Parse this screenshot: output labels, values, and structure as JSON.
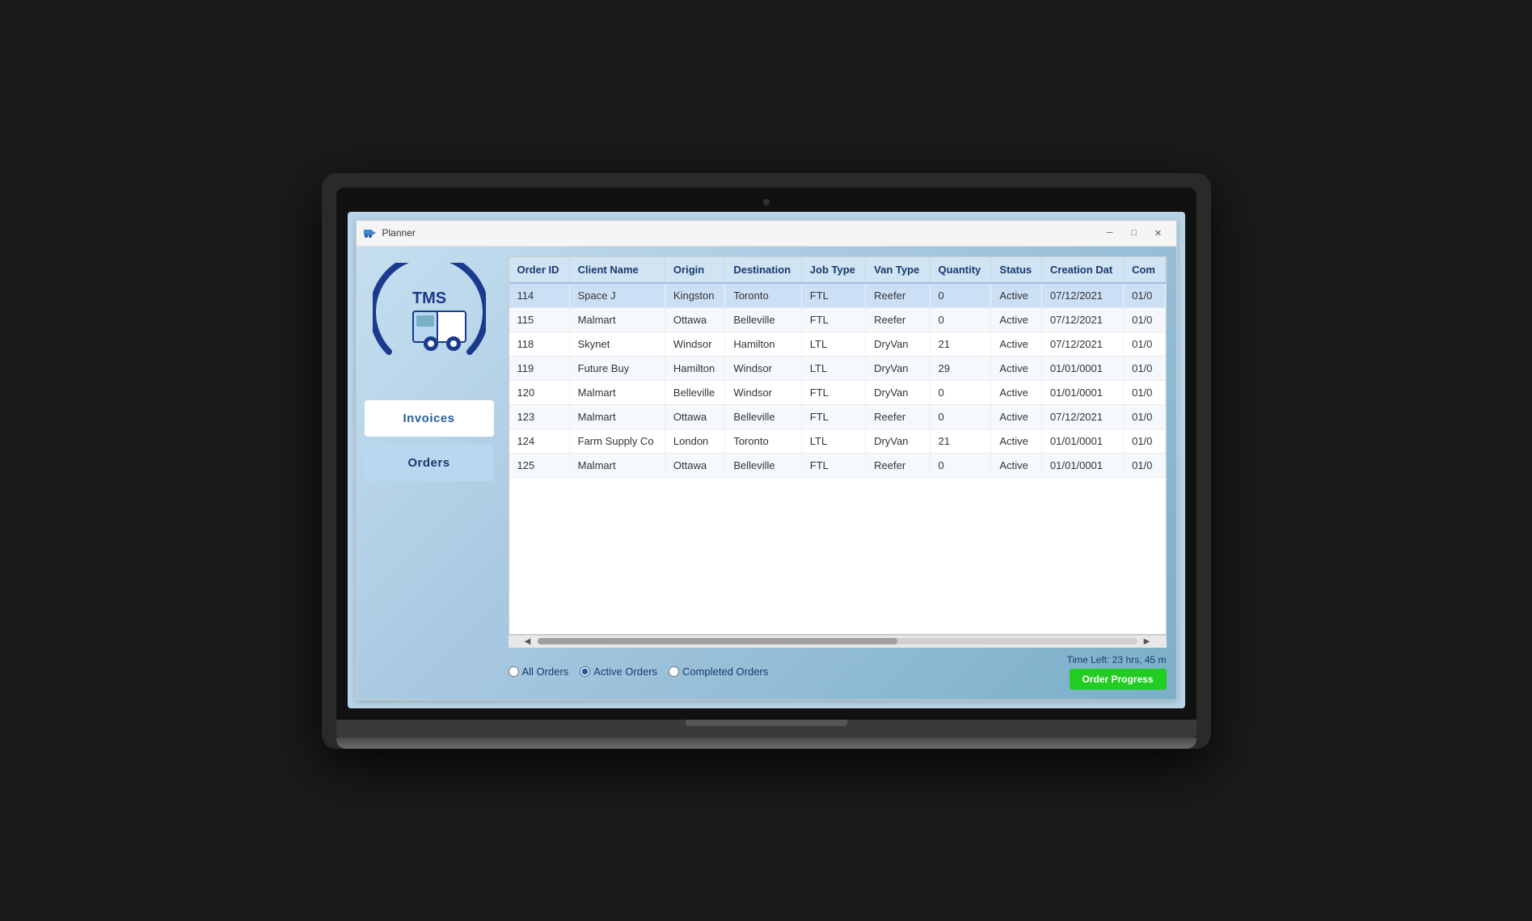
{
  "app": {
    "title": "Planner",
    "icon": "🚛"
  },
  "titlebar": {
    "minimize_label": "─",
    "maximize_label": "□",
    "close_label": "✕"
  },
  "table": {
    "columns": [
      "Order ID",
      "Client Name",
      "Origin",
      "Destination",
      "Job Type",
      "Van Type",
      "Quantity",
      "Status",
      "Creation Dat",
      "Com"
    ],
    "rows": [
      {
        "id": "114",
        "client": "Space J",
        "origin": "Kingston",
        "destination": "Toronto",
        "job_type": "FTL",
        "van_type": "Reefer",
        "quantity": "0",
        "status": "Active",
        "creation": "07/12/2021",
        "com": "01/0"
      },
      {
        "id": "115",
        "client": "Malmart",
        "origin": "Ottawa",
        "destination": "Belleville",
        "job_type": "FTL",
        "van_type": "Reefer",
        "quantity": "0",
        "status": "Active",
        "creation": "07/12/2021",
        "com": "01/0"
      },
      {
        "id": "118",
        "client": "Skynet",
        "origin": "Windsor",
        "destination": "Hamilton",
        "job_type": "LTL",
        "van_type": "DryVan",
        "quantity": "21",
        "status": "Active",
        "creation": "07/12/2021",
        "com": "01/0"
      },
      {
        "id": "119",
        "client": "Future Buy",
        "origin": "Hamilton",
        "destination": "Windsor",
        "job_type": "LTL",
        "van_type": "DryVan",
        "quantity": "29",
        "status": "Active",
        "creation": "01/01/0001",
        "com": "01/0"
      },
      {
        "id": "120",
        "client": "Malmart",
        "origin": "Belleville",
        "destination": "Windsor",
        "job_type": "FTL",
        "van_type": "DryVan",
        "quantity": "0",
        "status": "Active",
        "creation": "01/01/0001",
        "com": "01/0"
      },
      {
        "id": "123",
        "client": "Malmart",
        "origin": "Ottawa",
        "destination": "Belleville",
        "job_type": "FTL",
        "van_type": "Reefer",
        "quantity": "0",
        "status": "Active",
        "creation": "07/12/2021",
        "com": "01/0"
      },
      {
        "id": "124",
        "client": "Farm Supply Co",
        "origin": "London",
        "destination": "Toronto",
        "job_type": "LTL",
        "van_type": "DryVan",
        "quantity": "21",
        "status": "Active",
        "creation": "01/01/0001",
        "com": "01/0"
      },
      {
        "id": "125",
        "client": "Malmart",
        "origin": "Ottawa",
        "destination": "Belleville",
        "job_type": "FTL",
        "van_type": "Reefer",
        "quantity": "0",
        "status": "Active",
        "creation": "01/01/0001",
        "com": "01/0"
      }
    ]
  },
  "sidebar": {
    "logo_text": "TMS",
    "invoices_label": "Invoices",
    "orders_label": "Orders"
  },
  "filters": {
    "all_orders_label": "All Orders",
    "active_orders_label": "Active Orders",
    "completed_orders_label": "Completed Orders",
    "selected": "active"
  },
  "status": {
    "time_left_label": "Time Left: 23 hrs, 45 m",
    "order_progress_label": "Order Progress"
  }
}
